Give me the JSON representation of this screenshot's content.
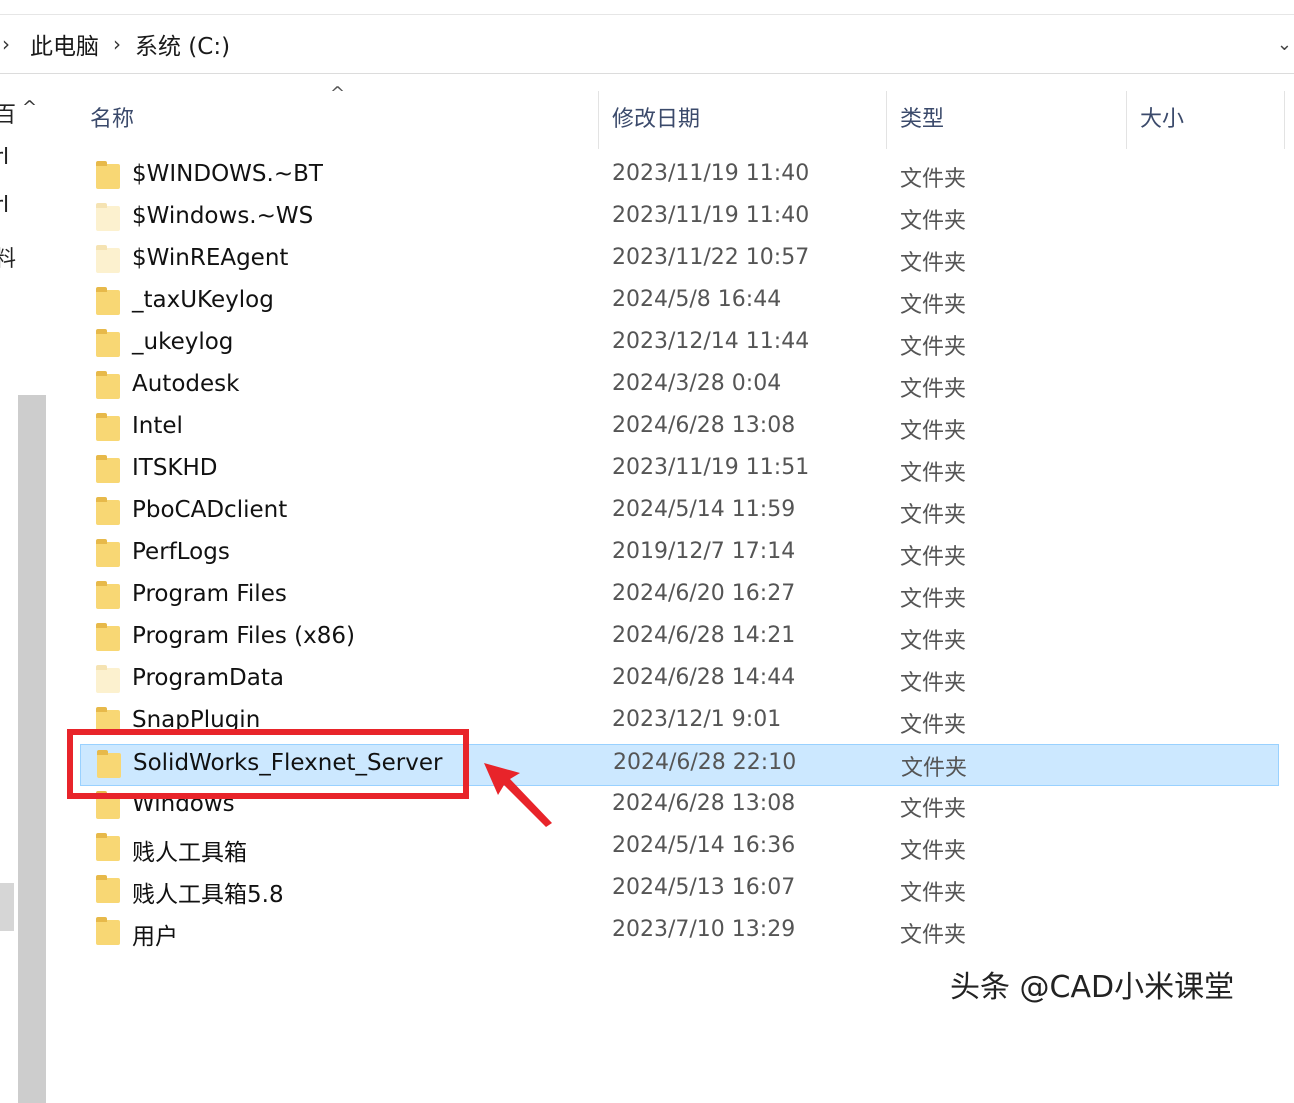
{
  "breadcrumb": {
    "items": [
      "此电脑",
      "系统 (C:)"
    ],
    "separator": "›"
  },
  "columns": {
    "name": "名称",
    "date": "修改日期",
    "type": "类型",
    "size": "大小"
  },
  "files": [
    {
      "name": "$WINDOWS.~BT",
      "date": "2023/11/19 11:40",
      "type": "文件夹",
      "hidden": false
    },
    {
      "name": "$Windows.~WS",
      "date": "2023/11/19 11:40",
      "type": "文件夹",
      "hidden": true
    },
    {
      "name": "$WinREAgent",
      "date": "2023/11/22 10:57",
      "type": "文件夹",
      "hidden": true
    },
    {
      "name": "_taxUKeylog",
      "date": "2024/5/8 16:44",
      "type": "文件夹",
      "hidden": false
    },
    {
      "name": "_ukeylog",
      "date": "2023/12/14 11:44",
      "type": "文件夹",
      "hidden": false
    },
    {
      "name": "Autodesk",
      "date": "2024/3/28 0:04",
      "type": "文件夹",
      "hidden": false
    },
    {
      "name": "Intel",
      "date": "2024/6/28 13:08",
      "type": "文件夹",
      "hidden": false
    },
    {
      "name": "ITSKHD",
      "date": "2023/11/19 11:51",
      "type": "文件夹",
      "hidden": false
    },
    {
      "name": "PboCADclient",
      "date": "2024/5/14 11:59",
      "type": "文件夹",
      "hidden": false
    },
    {
      "name": "PerfLogs",
      "date": "2019/12/7 17:14",
      "type": "文件夹",
      "hidden": false
    },
    {
      "name": "Program Files",
      "date": "2024/6/20 16:27",
      "type": "文件夹",
      "hidden": false
    },
    {
      "name": "Program Files (x86)",
      "date": "2024/6/28 14:21",
      "type": "文件夹",
      "hidden": false
    },
    {
      "name": "ProgramData",
      "date": "2024/6/28 14:44",
      "type": "文件夹",
      "hidden": true
    },
    {
      "name": "SnapPlugin",
      "date": "2023/12/1 9:01",
      "type": "文件夹",
      "hidden": false
    },
    {
      "name": "SolidWorks_Flexnet_Server",
      "date": "2024/6/28 22:10",
      "type": "文件夹",
      "hidden": false,
      "selected": true
    },
    {
      "name": "Windows",
      "date": "2024/6/28 13:08",
      "type": "文件夹",
      "hidden": false
    },
    {
      "name": "贱人工具箱",
      "date": "2024/5/14 16:36",
      "type": "文件夹",
      "hidden": false
    },
    {
      "name": "贱人工具箱5.8",
      "date": "2024/5/13 16:07",
      "type": "文件夹",
      "hidden": false
    },
    {
      "name": "用户",
      "date": "2023/7/10 13:29",
      "type": "文件夹",
      "hidden": false
    }
  ],
  "nav_fragments": [
    "百",
    "rl",
    "rl",
    "料"
  ],
  "watermark": "头条 @CAD小米课堂",
  "colors": {
    "selection_bg": "#cce8ff",
    "selection_border": "#99d1ff",
    "annotation_red": "#e8242a",
    "folder_yellow": "#f8d774"
  },
  "icons": {
    "folder": "folder-icon",
    "sort": "sort-ascending-icon",
    "chevron": "chevron-right-icon",
    "dropdown": "chevron-down-icon"
  }
}
